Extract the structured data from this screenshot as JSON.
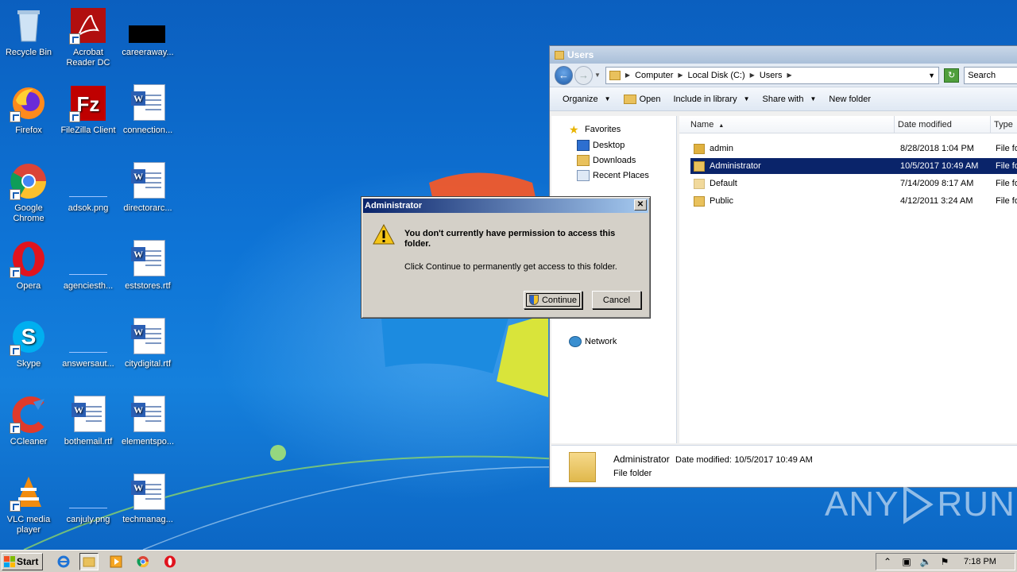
{
  "desktop_icons": [
    {
      "label": "Recycle Bin",
      "icon": "recycle-bin-icon"
    },
    {
      "label": "Acrobat\nReader DC",
      "icon": "acrobat-icon"
    },
    {
      "label": "careeraway...",
      "icon": "black-image-icon"
    },
    {
      "label": "Firefox",
      "icon": "firefox-icon"
    },
    {
      "label": "FileZilla Client",
      "icon": "filezilla-icon"
    },
    {
      "label": "connection...",
      "icon": "word-doc-icon"
    },
    {
      "label": "Google\nChrome",
      "icon": "chrome-icon"
    },
    {
      "label": "adsok.png",
      "icon": "image-file-icon"
    },
    {
      "label": "directorarc...",
      "icon": "word-doc-icon"
    },
    {
      "label": "Opera",
      "icon": "opera-icon"
    },
    {
      "label": "agenciesth...",
      "icon": "image-file-icon"
    },
    {
      "label": "eststores.rtf",
      "icon": "word-doc-icon"
    },
    {
      "label": "Skype",
      "icon": "skype-icon"
    },
    {
      "label": "answersaut...",
      "icon": "image-file-icon"
    },
    {
      "label": "citydigital.rtf",
      "icon": "word-doc-icon"
    },
    {
      "label": "CCleaner",
      "icon": "ccleaner-icon"
    },
    {
      "label": "bothemail.rtf",
      "icon": "word-doc-icon"
    },
    {
      "label": "elementspo...",
      "icon": "word-doc-icon"
    },
    {
      "label": "VLC media\nplayer",
      "icon": "vlc-icon"
    },
    {
      "label": "canjuly.png",
      "icon": "image-file-icon"
    },
    {
      "label": "techmanag...",
      "icon": "word-doc-icon"
    }
  ],
  "explorer": {
    "title": "Users",
    "breadcrumb": [
      "Computer",
      "Local Disk (C:)",
      "Users"
    ],
    "search_placeholder": "Search",
    "toolbar": {
      "organize": "Organize",
      "open": "Open",
      "include_in_library": "Include in library",
      "share_with": "Share with",
      "new_folder": "New folder"
    },
    "nav": {
      "favorites": "Favorites",
      "desktop": "Desktop",
      "downloads": "Downloads",
      "recent_places": "Recent Places",
      "network": "Network"
    },
    "columns": {
      "name": "Name",
      "date_modified": "Date modified",
      "type": "Type"
    },
    "rows": [
      {
        "name": "admin",
        "date": "8/28/2018 1:04 PM",
        "type": "File fo"
      },
      {
        "name": "Administrator",
        "date": "10/5/2017 10:49 AM",
        "type": "File fo"
      },
      {
        "name": "Default",
        "date": "7/14/2009 8:17 AM",
        "type": "File fo"
      },
      {
        "name": "Public",
        "date": "4/12/2011 3:24 AM",
        "type": "File fo"
      }
    ],
    "selected_row": 1,
    "details": {
      "name": "Administrator",
      "date_label": "Date modified:",
      "date_value": "10/5/2017 10:49 AM",
      "type": "File folder"
    }
  },
  "dialog": {
    "title": "Administrator",
    "close": "✕",
    "message": "You don't currently have permission to access this folder.",
    "sub": "Click Continue to permanently get access to this folder.",
    "continue": "Continue",
    "cancel": "Cancel"
  },
  "taskbar": {
    "start": "Start",
    "clock": "7:18 PM"
  },
  "watermark": {
    "left": "ANY",
    "right": "RUN"
  }
}
